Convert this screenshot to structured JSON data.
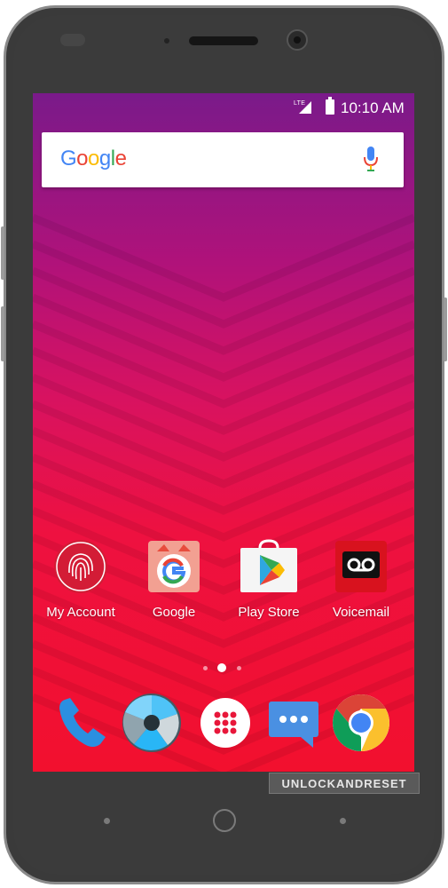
{
  "status_bar": {
    "network": "LTE",
    "time": "10:10 AM"
  },
  "search": {
    "logo": "Google",
    "logo_colors": [
      "#4285F4",
      "#EA4335",
      "#FBBC05",
      "#4285F4",
      "#34A853",
      "#EA4335"
    ],
    "icon": "mic-icon"
  },
  "apps": [
    {
      "label": "My Account",
      "icon": "fingerprint-icon"
    },
    {
      "label": "Google",
      "icon": "google-g-icon"
    },
    {
      "label": "Play Store",
      "icon": "play-store-icon"
    },
    {
      "label": "Voicemail",
      "icon": "voicemail-icon"
    }
  ],
  "pager": {
    "pages": 3,
    "current": 2
  },
  "dock": [
    {
      "icon": "phone-icon"
    },
    {
      "icon": "camera-icon"
    },
    {
      "icon": "app-drawer-icon"
    },
    {
      "icon": "messages-icon"
    },
    {
      "icon": "chrome-icon"
    }
  ],
  "watermark": "UNLOCKANDRESET",
  "colors": {
    "wallpaper_top": "#7a1a8a",
    "wallpaper_bottom": "#f2102e",
    "phone_body": "#3a3a3a"
  }
}
